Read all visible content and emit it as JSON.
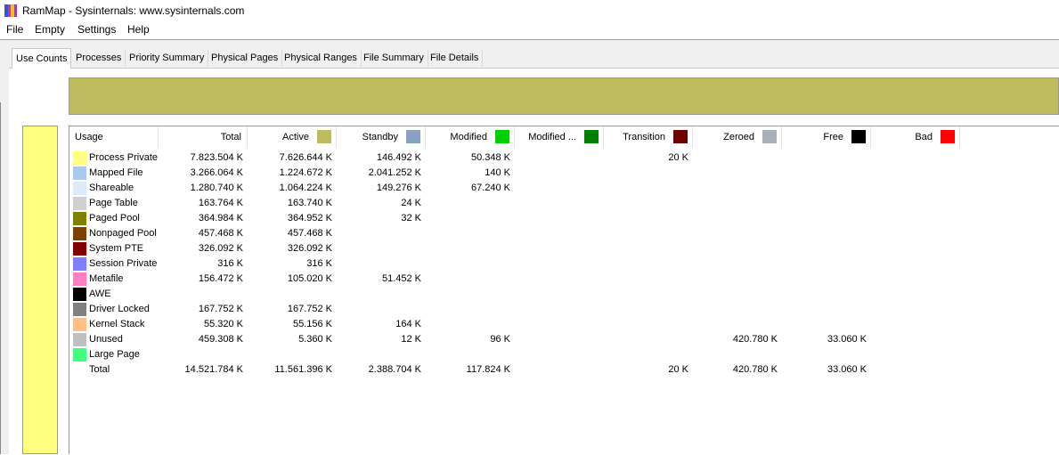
{
  "window": {
    "title": "RamMap - Sysinternals: www.sysinternals.com"
  },
  "menu": [
    "File",
    "Empty",
    "Settings",
    "Help"
  ],
  "tabs": [
    "Use Counts",
    "Processes",
    "Priority Summary",
    "Physical Pages",
    "Physical Ranges",
    "File Summary",
    "File Details"
  ],
  "active_tab": "Use Counts",
  "columns": [
    {
      "label": "Usage"
    },
    {
      "label": "Total"
    },
    {
      "label": "Active",
      "color": "#bfbc5e"
    },
    {
      "label": "Standby",
      "color": "#8aa0bf"
    },
    {
      "label": "Modified",
      "color": "#00d000"
    },
    {
      "label": "Modified ...",
      "color": "#008000"
    },
    {
      "label": "Transition",
      "color": "#6e0000"
    },
    {
      "label": "Zeroed",
      "color": "#a9b0ba"
    },
    {
      "label": "Free",
      "color": "#000000"
    },
    {
      "label": "Bad",
      "color": "#ff0000"
    }
  ],
  "rows": [
    {
      "label": "Process Private",
      "color": "#ffff80",
      "cells": [
        "7.823.504 K",
        "7.626.644 K",
        "146.492 K",
        "50.348 K",
        "",
        "20 K",
        "",
        "",
        ""
      ]
    },
    {
      "label": "Mapped File",
      "color": "#a6caf0",
      "cells": [
        "3.266.064 K",
        "1.224.672 K",
        "2.041.252 K",
        "140 K",
        "",
        "",
        "",
        "",
        ""
      ]
    },
    {
      "label": "Shareable",
      "color": "#dcebfa",
      "cells": [
        "1.280.740 K",
        "1.064.224 K",
        "149.276 K",
        "67.240 K",
        "",
        "",
        "",
        "",
        ""
      ]
    },
    {
      "label": "Page Table",
      "color": "#d0d0d0",
      "cells": [
        "163.764 K",
        "163.740 K",
        "24 K",
        "",
        "",
        "",
        "",
        "",
        ""
      ]
    },
    {
      "label": "Paged Pool",
      "color": "#808000",
      "cells": [
        "364.984 K",
        "364.952 K",
        "32 K",
        "",
        "",
        "",
        "",
        "",
        ""
      ]
    },
    {
      "label": "Nonpaged Pool",
      "color": "#804000",
      "cells": [
        "457.468 K",
        "457.468 K",
        "",
        "",
        "",
        "",
        "",
        "",
        ""
      ]
    },
    {
      "label": "System PTE",
      "color": "#800000",
      "cells": [
        "326.092 K",
        "326.092 K",
        "",
        "",
        "",
        "",
        "",
        "",
        ""
      ]
    },
    {
      "label": "Session Private",
      "color": "#8080ff",
      "cells": [
        "316 K",
        "316 K",
        "",
        "",
        "",
        "",
        "",
        "",
        ""
      ]
    },
    {
      "label": "Metafile",
      "color": "#ff80c0",
      "cells": [
        "156.472 K",
        "105.020 K",
        "51.452 K",
        "",
        "",
        "",
        "",
        "",
        ""
      ]
    },
    {
      "label": "AWE",
      "color": "#000000",
      "cells": [
        "",
        "",
        "",
        "",
        "",
        "",
        "",
        "",
        ""
      ]
    },
    {
      "label": "Driver Locked",
      "color": "#808080",
      "cells": [
        "167.752 K",
        "167.752 K",
        "",
        "",
        "",
        "",
        "",
        "",
        ""
      ]
    },
    {
      "label": "Kernel Stack",
      "color": "#ffc080",
      "cells": [
        "55.320 K",
        "55.156 K",
        "164 K",
        "",
        "",
        "",
        "",
        "",
        ""
      ]
    },
    {
      "label": "Unused",
      "color": "#c0c0c0",
      "cells": [
        "459.308 K",
        "5.360 K",
        "12 K",
        "96 K",
        "",
        "",
        "420.780 K",
        "33.060 K",
        ""
      ]
    },
    {
      "label": "Large Page",
      "color": "#40ff80",
      "cells": [
        "",
        "",
        "",
        "",
        "",
        "",
        "",
        "",
        ""
      ]
    },
    {
      "label": "Total",
      "color": "",
      "cells": [
        "14.521.784 K",
        "11.561.396 K",
        "2.388.704 K",
        "117.824 K",
        "",
        "20 K",
        "420.780 K",
        "33.060 K",
        ""
      ]
    }
  ],
  "bars": {
    "left_color": "#ffff80",
    "top_color": "#bfbc5e"
  }
}
